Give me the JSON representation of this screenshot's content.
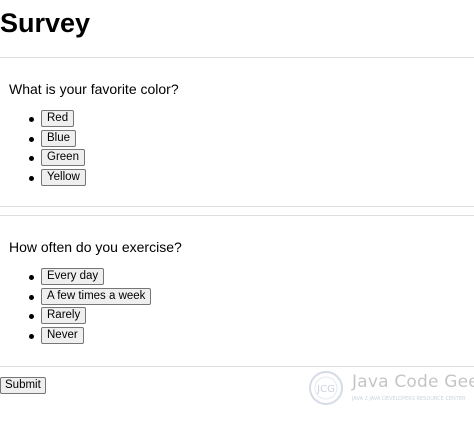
{
  "header": {
    "title": "Survey"
  },
  "questions": [
    {
      "text": "What is your favorite color?",
      "options": [
        "Red",
        "Blue",
        "Green",
        "Yellow"
      ]
    },
    {
      "text": "How often do you exercise?",
      "options": [
        "Every day",
        "A few times a week",
        "Rarely",
        "Never"
      ]
    }
  ],
  "submit_label": "Submit",
  "watermark": {
    "brand": "Java Code Geeks",
    "logo_text": "JCG",
    "tagline": "JAVA 2 JAVA DEVELOPERS RESOURCE CENTER"
  },
  "colors": {
    "divider": "#dedede",
    "button_bg": "#efefef",
    "button_border": "#767676"
  }
}
